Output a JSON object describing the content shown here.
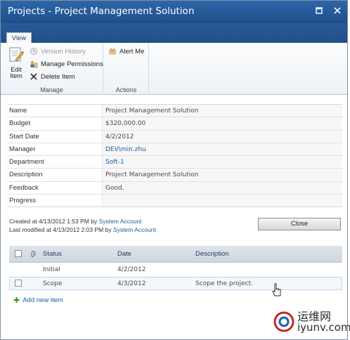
{
  "window": {
    "title": "Projects - Project Management Solution",
    "restore_glyph": "▫",
    "close_glyph": "✕"
  },
  "ribbon": {
    "tab": "View",
    "manage": {
      "label": "Manage",
      "edit_item_l1": "Edit",
      "edit_item_l2": "Item",
      "version_history": "Version History",
      "manage_permissions": "Manage Permissions",
      "delete_item": "Delete Item"
    },
    "actions": {
      "label": "Actions",
      "alert_me": "Alert Me"
    }
  },
  "properties": [
    {
      "label": "Name",
      "value": "Project Management Solution",
      "link": false
    },
    {
      "label": "Budget",
      "value": "$320,000.00",
      "link": false
    },
    {
      "label": "Start Date",
      "value": "4/2/2012",
      "link": false
    },
    {
      "label": "Manager",
      "value": "DEV\\min.zhu",
      "link": true
    },
    {
      "label": "Department",
      "value": "Soft-1",
      "link": true
    },
    {
      "label": "Description",
      "value": "Project Management Solution",
      "link": false
    },
    {
      "label": "Feedback",
      "value": "Good.",
      "link": false
    },
    {
      "label": "Progress",
      "value": "",
      "link": false
    }
  ],
  "meta": {
    "created_prefix": "Created at 4/13/2012 1:53 PM by ",
    "created_by": "System Account",
    "modified_prefix": "Last modified at 4/13/2012 2:03 PM by ",
    "modified_by": "System Account"
  },
  "close_button": "Close",
  "grid": {
    "headers": {
      "status": "Status",
      "date": "Date",
      "description": "Description"
    },
    "rows": [
      {
        "status": "Initial",
        "date": "4/2/2012",
        "description": ""
      },
      {
        "status": "Scope",
        "date": "4/3/2012",
        "description": "Scope the project."
      }
    ],
    "add_new": "Add new item"
  },
  "watermark": {
    "line1": "运维网",
    "line2": "iyunv.com"
  },
  "colors": {
    "titlebar": "#2d66a8",
    "link": "#1e5d99",
    "grid_header": "#dfe4ea",
    "add_plus": "#3a9a2a"
  }
}
